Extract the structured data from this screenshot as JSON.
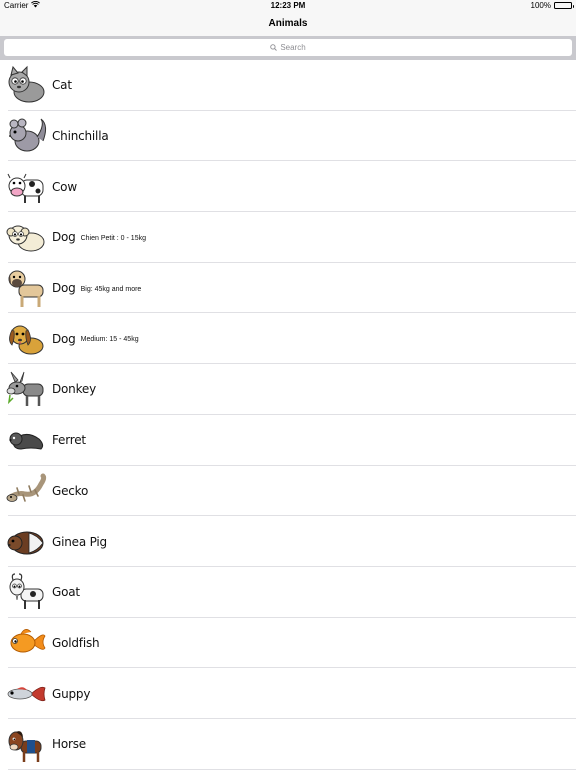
{
  "status": {
    "carrier": "Carrier",
    "time": "12:23 PM",
    "battery": "100%"
  },
  "nav": {
    "title": "Animals"
  },
  "search": {
    "placeholder": "Search"
  },
  "animals": [
    {
      "name": "Cat",
      "detail": "",
      "icon": "cat-icon"
    },
    {
      "name": "Chinchilla",
      "detail": "",
      "icon": "chinchilla-icon"
    },
    {
      "name": "Cow",
      "detail": "",
      "icon": "cow-icon"
    },
    {
      "name": "Dog",
      "detail": "Chien Petit : 0 - 15kg",
      "icon": "small-dog-icon"
    },
    {
      "name": "Dog",
      "detail": "Big: 45kg and more",
      "icon": "big-dog-icon"
    },
    {
      "name": "Dog",
      "detail": "Medium: 15 - 45kg",
      "icon": "medium-dog-icon"
    },
    {
      "name": "Donkey",
      "detail": "",
      "icon": "donkey-icon"
    },
    {
      "name": "Ferret",
      "detail": "",
      "icon": "ferret-icon"
    },
    {
      "name": "Gecko",
      "detail": "",
      "icon": "gecko-icon"
    },
    {
      "name": "Ginea Pig",
      "detail": "",
      "icon": "guinea-pig-icon"
    },
    {
      "name": "Goat",
      "detail": "",
      "icon": "goat-icon"
    },
    {
      "name": "Goldfish",
      "detail": "",
      "icon": "goldfish-icon"
    },
    {
      "name": "Guppy",
      "detail": "",
      "icon": "guppy-icon"
    },
    {
      "name": "Horse",
      "detail": "",
      "icon": "horse-icon"
    }
  ]
}
